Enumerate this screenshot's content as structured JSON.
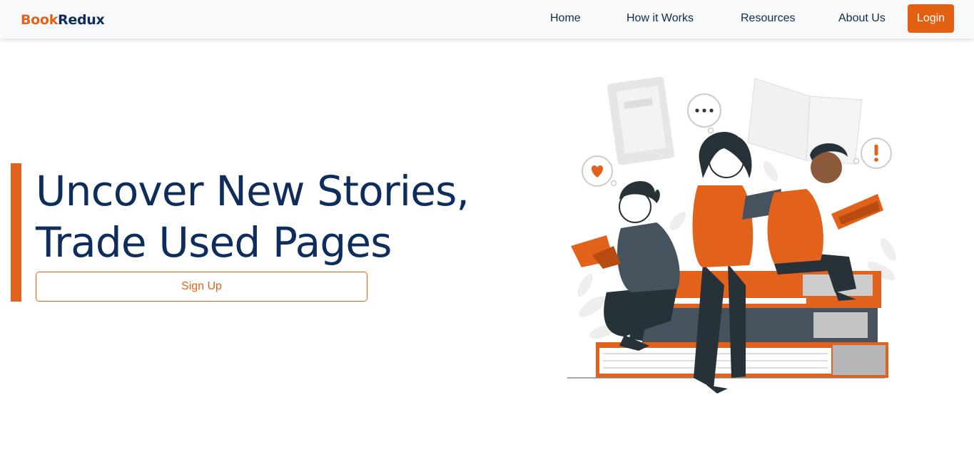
{
  "navbar": {
    "logo": {
      "part1": "Book",
      "part2": "Redux"
    },
    "links": [
      {
        "label": "Home"
      },
      {
        "label": "How it Works"
      },
      {
        "label": "Resources"
      },
      {
        "label": "About Us"
      }
    ],
    "login_label": "Login"
  },
  "hero": {
    "title_line1": "Uncover New Stories,",
    "title_line2": "Trade Used Pages",
    "signup_label": "Sign Up"
  },
  "colors": {
    "accent": "#e2621b",
    "brand_navy": "#0f2d5c",
    "nav_bg": "#f8f9fa"
  },
  "illustration": {
    "icons": [
      "heart-icon",
      "ellipsis-icon",
      "exclamation-icon"
    ]
  }
}
